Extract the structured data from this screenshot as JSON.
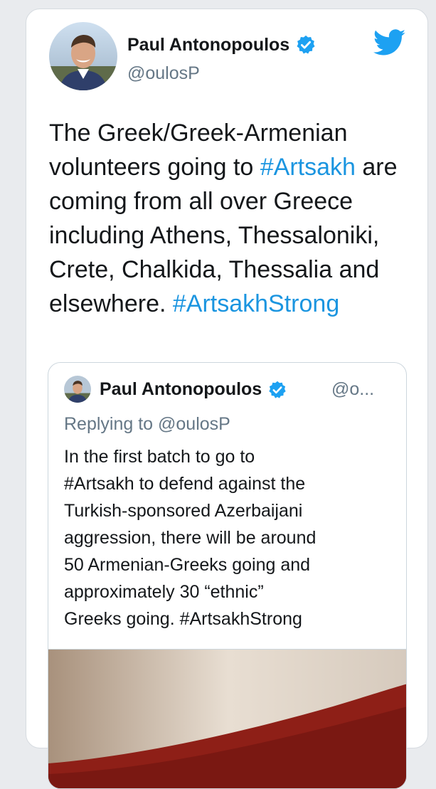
{
  "tweet": {
    "author_name": "Paul Antonopoulos",
    "handle": "@oulosP",
    "text_segments": [
      {
        "text": "The Greek/Greek-Armenian volunteers going to ",
        "type": "text"
      },
      {
        "text": "#Artsakh",
        "type": "hashtag"
      },
      {
        "text": " are coming from all over Greece including Athens, Thessaloniki, Crete, Chalkida, Thessalia and elsewhere. ",
        "type": "text"
      },
      {
        "text": "#ArtsakhStrong",
        "type": "hashtag"
      }
    ]
  },
  "quoted_tweet": {
    "author_name": "Paul Antonopoulos",
    "handle_truncated": "@o...",
    "replying_to": "Replying to @oulosP",
    "text_lines": [
      "In the first batch to go to",
      "#Artsakh to defend against the",
      "Turkish-sponsored Azerbaijani",
      "aggression, there will be around",
      "50 Armenian-Greeks going and",
      "approximately 30 “ethnic”",
      "Greeks going. #ArtsakhStrong"
    ]
  },
  "icons": {
    "verified": "verified-badge-icon",
    "brand": "twitter-bird-icon"
  },
  "colors": {
    "link": "#1b95e0",
    "twitter_blue": "#1da1f2",
    "text": "#14171a",
    "secondary_text": "#657786",
    "border": "#ccd6dd"
  }
}
